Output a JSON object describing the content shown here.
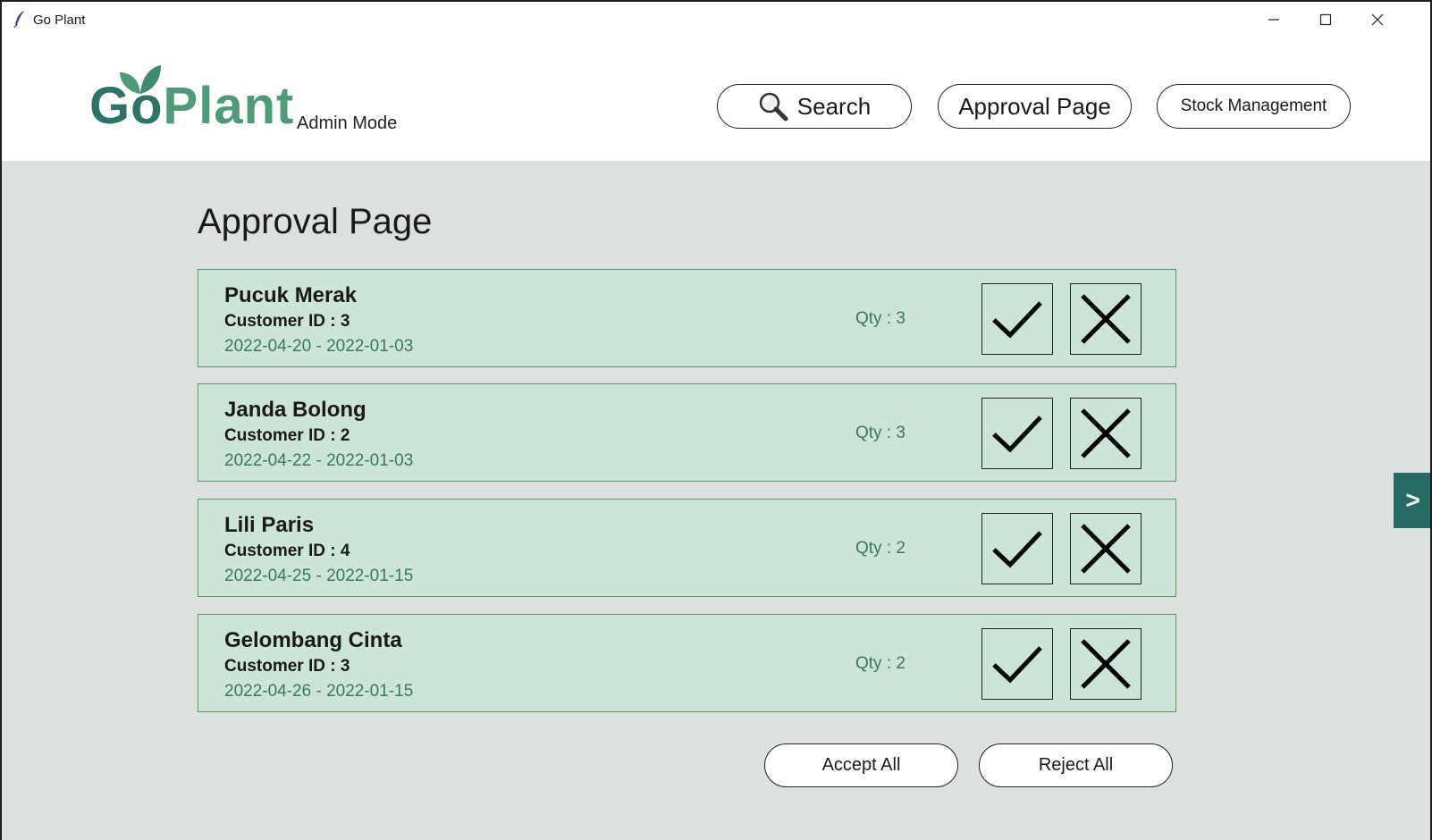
{
  "window": {
    "title": "Go Plant"
  },
  "header": {
    "logo_go": "Go",
    "logo_plant": "Plant",
    "mode_label": "Admin Mode",
    "nav": {
      "search_label": "Search",
      "approval_label": "Approval Page",
      "stock_label": "Stock Management"
    }
  },
  "main": {
    "title": "Approval Page",
    "requests": [
      {
        "name": "Pucuk Merak",
        "customer": "Customer ID : 3",
        "dates": "2022-04-20 - 2022-01-03",
        "qty": "Qty : 3"
      },
      {
        "name": "Janda Bolong",
        "customer": "Customer ID : 2",
        "dates": "2022-04-22 - 2022-01-03",
        "qty": "Qty : 3"
      },
      {
        "name": "Lili Paris",
        "customer": "Customer ID : 4",
        "dates": "2022-04-25 - 2022-01-15",
        "qty": "Qty : 2"
      },
      {
        "name": "Gelombang Cinta",
        "customer": "Customer ID : 3",
        "dates": "2022-04-26 - 2022-01-15",
        "qty": "Qty : 2"
      }
    ],
    "accept_all_label": "Accept All",
    "reject_all_label": "Reject All",
    "next_label": ">"
  },
  "colors": {
    "brand_dark": "#2d7367",
    "brand_light": "#4e9a79",
    "card_bg": "#cde4d8",
    "card_border": "#5a9a63",
    "page_bg": "#dde1de",
    "next_tab_bg": "#256b63"
  },
  "icons": {
    "app": "feather-icon",
    "search": "magnifier-icon",
    "accept": "checkmark-icon",
    "reject": "x-icon",
    "window_controls": [
      "minimize-icon",
      "maximize-icon",
      "close-icon"
    ]
  }
}
